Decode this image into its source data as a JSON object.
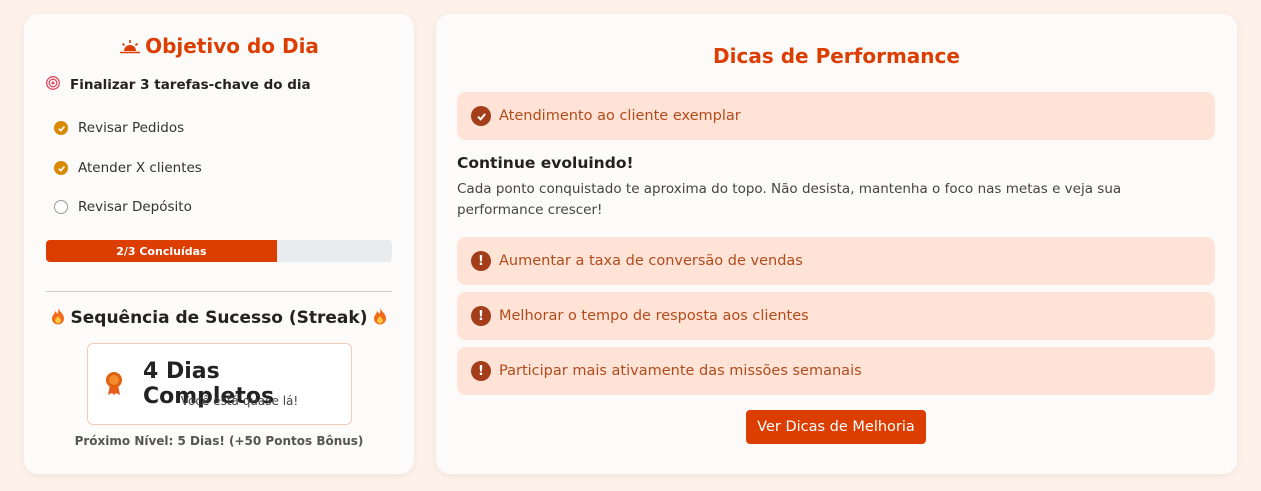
{
  "daily_goal": {
    "title": "Objetivo do Dia",
    "goal": "Finalizar 3 tarefas-chave do dia",
    "tasks": [
      {
        "label": "Revisar Pedidos",
        "done": true
      },
      {
        "label": "Atender X clientes",
        "done": true
      },
      {
        "label": "Revisar Depósito",
        "done": false
      }
    ],
    "progress_label": "2/3 Concluídas",
    "progress_fraction": 0.667
  },
  "streak": {
    "title": "Sequência de Sucesso (Streak)",
    "days": "4 Dias Completos",
    "subtitle": "Você está quase lá!",
    "next_level": "Próximo Nível: 5 Dias! (+50 Pontos Bônus)"
  },
  "performance": {
    "title": "Dicas de Performance",
    "achievement": "Atendimento ao cliente exemplar",
    "evolve_title": "Continue evoluindo!",
    "evolve_text": "Cada ponto conquistado te aproxima do topo. Não desista, mantenha o foco nas metas e veja sua performance crescer!",
    "tips": [
      "Aumentar a taxa de conversão de vendas",
      "Melhorar o tempo de resposta aos clientes",
      "Participar mais ativamente das missões semanais"
    ],
    "button_label": "Ver Dicas de Melhoria"
  },
  "colors": {
    "accent": "#dc3d00",
    "check": "#d98a00",
    "tip_bg": "#ffe3d6"
  }
}
